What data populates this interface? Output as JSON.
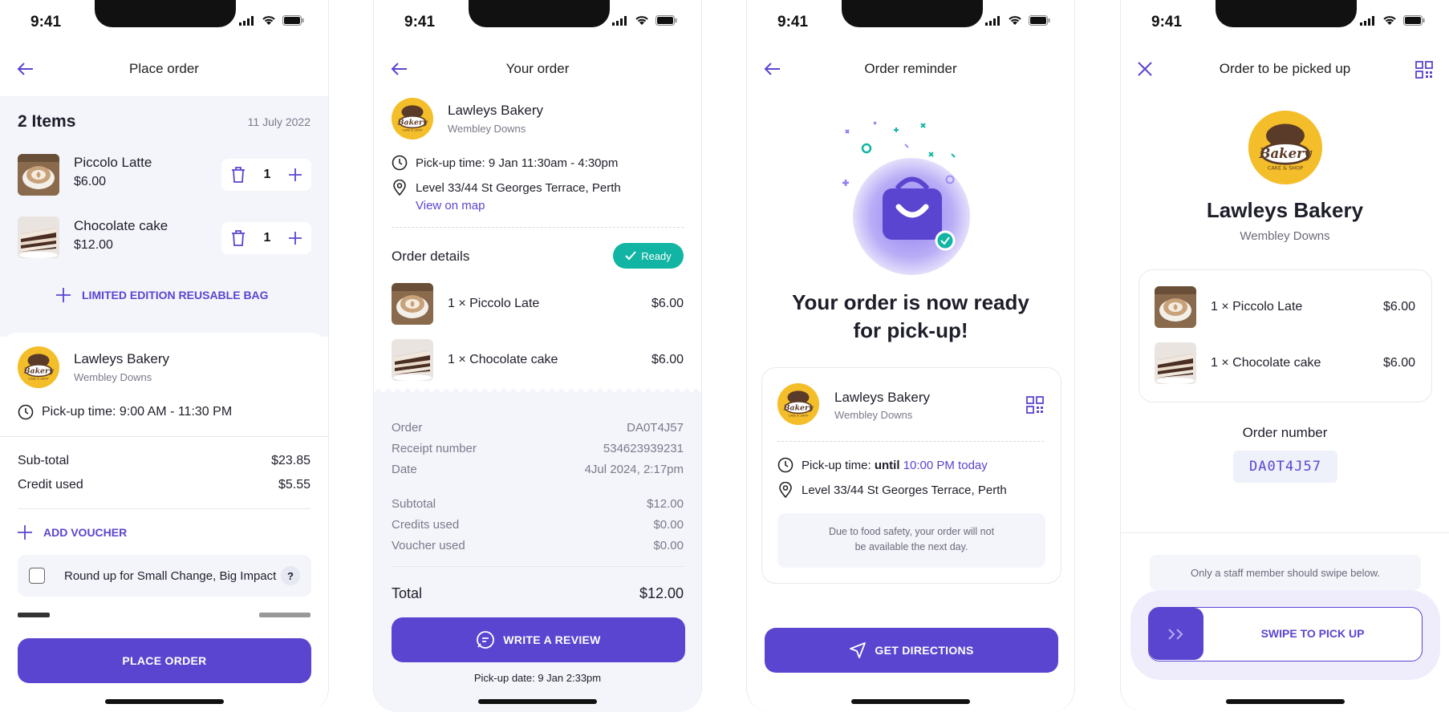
{
  "status_time": "9:41",
  "colors": {
    "accent": "#5a45d0",
    "teal": "#12b5a4",
    "panel": "#f3f5fb",
    "logo": "#f4bd2a"
  },
  "screen1": {
    "title": "Place order",
    "items_count": "2 Items",
    "date": "11 July 2022",
    "items": [
      {
        "name": "Piccolo Latte",
        "price": "$6.00",
        "qty": "1"
      },
      {
        "name": "Chocolate cake",
        "price": "$12.00",
        "qty": "1"
      }
    ],
    "add_bag": "LIMITED EDITION REUSABLE BAG",
    "store": {
      "name": "Lawleys Bakery",
      "suburb": "Wembley Downs"
    },
    "pickup_label": "Pick-up time: ",
    "pickup_value": "9:00 AM - 11:30 PM",
    "subtotal_label": "Sub-total",
    "subtotal_value": "$23.85",
    "credit_label": "Credit used",
    "credit_value": "$5.55",
    "add_voucher": "ADD VOUCHER",
    "roundup_label": "Round up for Small Change, Big Impact",
    "roundup_help": "?",
    "place_order": "PLACE ORDER"
  },
  "screen2": {
    "title": "Your order",
    "store": {
      "name": "Lawleys Bakery",
      "suburb": "Wembley Downs"
    },
    "pickup_label": "Pick-up time: ",
    "pickup_value": "9 Jan 11:30am - 4:30pm",
    "address": "Level 33/44 St Georges Terrace, Perth",
    "view_map": "View on map",
    "order_details": "Order details",
    "status": "Ready",
    "items": [
      {
        "name": "1 × Piccolo Late",
        "price": "$6.00"
      },
      {
        "name": "1 × Chocolate cake",
        "price": "$6.00"
      }
    ],
    "order_label": "Order",
    "order_value": "DA0T4J57",
    "receipt_label": "Receipt number",
    "receipt_value": "534623939231",
    "date_label": "Date",
    "date_value": "4Jul 2024, 2:17pm",
    "subtotal_label": "Subtotal",
    "subtotal_value": "$12.00",
    "credits_label": "Credits used",
    "credits_value": "$0.00",
    "voucher_label": "Voucher used",
    "voucher_value": "$0.00",
    "total_label": "Total",
    "total_value": "$12.00",
    "review_button": "WRITE A REVIEW",
    "pickup_date": "Pick-up date: 9 Jan 2:33pm"
  },
  "screen3": {
    "title": "Order reminder",
    "headline": "Your order is now ready for pick-up!",
    "store": {
      "name": "Lawleys Bakery",
      "suburb": "Wembley Downs"
    },
    "pickup_label": "Pick-up time: ",
    "pickup_until": "until ",
    "pickup_value": "10:00 PM today",
    "address": "Level 33/44 St Georges Terrace, Perth",
    "notice": "Due to food safety, your order will not be available the next day.",
    "directions_button": "GET DIRECTIONS"
  },
  "screen4": {
    "title": "Order to be picked up",
    "store": {
      "name": "Lawleys Bakery",
      "suburb": "Wembley Downs"
    },
    "items": [
      {
        "name": "1 × Piccolo Late",
        "price": "$6.00"
      },
      {
        "name": "1 × Chocolate cake",
        "price": "$6.00"
      }
    ],
    "order_number_label": "Order number",
    "order_number": "DA0T4J57",
    "staff_note": "Only a staff member should swipe below.",
    "swipe_label": "SWIPE TO PICK UP"
  }
}
